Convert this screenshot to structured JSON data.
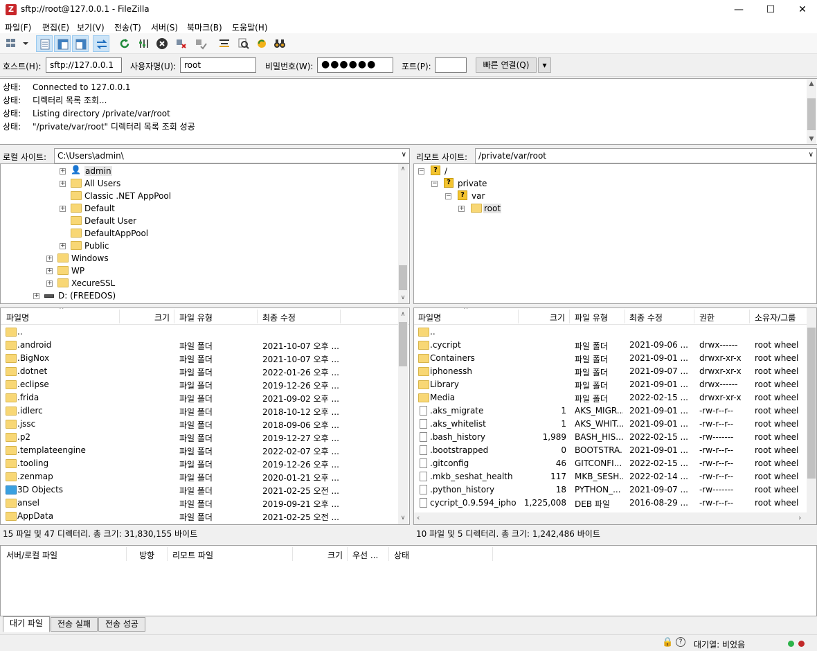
{
  "window": {
    "title": "sftp://root@127.0.0.1 - FileZilla",
    "icon": "filezilla-icon"
  },
  "menu": [
    "파일(F)",
    "편집(E)",
    "보기(V)",
    "전송(T)",
    "서버(S)",
    "북마크(B)",
    "도움말(H)"
  ],
  "quickconnect": {
    "host_label": "호스트(H):",
    "host_value": "sftp://127.0.0.1",
    "user_label": "사용자명(U):",
    "user_value": "root",
    "pass_label": "비밀번호(W):",
    "pass_value": "●●●●●●",
    "port_label": "포트(P):",
    "port_value": "",
    "connect_label": "빠른 연결(Q)",
    "dropdown": "▾"
  },
  "log": [
    {
      "key": "상태:",
      "msg": "Connected to 127.0.0.1"
    },
    {
      "key": "상태:",
      "msg": "디렉터리 목록 조회..."
    },
    {
      "key": "상태:",
      "msg": "Listing directory /private/var/root"
    },
    {
      "key": "상태:",
      "msg": "\"/private/var/root\" 디렉터리 목록 조회 성공"
    }
  ],
  "local": {
    "site_label": "로컬 사이트:",
    "path": "C:\\Users\\admin\\",
    "tree": [
      {
        "label": "admin",
        "icon": "user-folder",
        "expander": true
      },
      {
        "label": "All Users",
        "icon": "folder",
        "expander": true
      },
      {
        "label": "Classic .NET AppPool",
        "icon": "folder",
        "expander": false
      },
      {
        "label": "Default",
        "icon": "folder",
        "expander": true
      },
      {
        "label": "Default User",
        "icon": "folder",
        "expander": false
      },
      {
        "label": "DefaultAppPool",
        "icon": "folder",
        "expander": false
      },
      {
        "label": "Public",
        "icon": "folder",
        "expander": true
      },
      {
        "label": "Windows",
        "icon": "folder",
        "expander": true
      },
      {
        "label": "WP",
        "icon": "folder",
        "expander": true
      },
      {
        "label": "XecureSSL",
        "icon": "folder",
        "expander": true
      },
      {
        "label": "D: (FREEDOS)",
        "icon": "drive",
        "expander": true
      }
    ],
    "columns": [
      "파일명",
      "크기",
      "파일 유형",
      "최종 수정"
    ],
    "files": [
      {
        "name": "..",
        "size": "",
        "type": "",
        "modified": ""
      },
      {
        "name": ".android",
        "size": "",
        "type": "파일 폴더",
        "modified": "2021-10-07 오후 ..."
      },
      {
        "name": ".BigNox",
        "size": "",
        "type": "파일 폴더",
        "modified": "2021-10-07 오후 ..."
      },
      {
        "name": ".dotnet",
        "size": "",
        "type": "파일 폴더",
        "modified": "2022-01-26 오후 ..."
      },
      {
        "name": ".eclipse",
        "size": "",
        "type": "파일 폴더",
        "modified": "2019-12-26 오후 ..."
      },
      {
        "name": ".frida",
        "size": "",
        "type": "파일 폴더",
        "modified": "2021-09-02 오후 ..."
      },
      {
        "name": ".idlerc",
        "size": "",
        "type": "파일 폴더",
        "modified": "2018-10-12 오후 ..."
      },
      {
        "name": ".jssc",
        "size": "",
        "type": "파일 폴더",
        "modified": "2018-09-06 오후 ..."
      },
      {
        "name": ".p2",
        "size": "",
        "type": "파일 폴더",
        "modified": "2019-12-27 오후 ..."
      },
      {
        "name": ".templateengine",
        "size": "",
        "type": "파일 폴더",
        "modified": "2022-02-07 오후 ..."
      },
      {
        "name": ".tooling",
        "size": "",
        "type": "파일 폴더",
        "modified": "2019-12-26 오후 ..."
      },
      {
        "name": ".zenmap",
        "size": "",
        "type": "파일 폴더",
        "modified": "2020-01-21 오후 ..."
      },
      {
        "name": "3D Objects",
        "size": "",
        "type": "파일 폴더",
        "modified": "2021-02-25 오전 ..."
      },
      {
        "name": "ansel",
        "size": "",
        "type": "파일 폴더",
        "modified": "2019-09-21 오후 ..."
      },
      {
        "name": "AppData",
        "size": "",
        "type": "파일 폴더",
        "modified": "2021-02-25 오전 ..."
      }
    ],
    "status": "15 파일 및 47 디렉터리. 총 크기: 31,830,155 바이트"
  },
  "remote": {
    "site_label": "리모트 사이트:",
    "path": "/private/var/root",
    "tree": [
      {
        "label": "/",
        "depth": 0
      },
      {
        "label": "private",
        "depth": 1
      },
      {
        "label": "var",
        "depth": 2
      },
      {
        "label": "root",
        "depth": 3
      }
    ],
    "columns": [
      "파일명",
      "크기",
      "파일 유형",
      "최종 수정",
      "권한",
      "소유자/그룹"
    ],
    "files": [
      {
        "name": "..",
        "size": "",
        "type": "",
        "modified": "",
        "perm": "",
        "owner": "",
        "kind": "folder"
      },
      {
        "name": ".cycript",
        "size": "",
        "type": "파일 폴더",
        "modified": "2021-09-06 ...",
        "perm": "drwx------",
        "owner": "root wheel",
        "kind": "folder"
      },
      {
        "name": "Containers",
        "size": "",
        "type": "파일 폴더",
        "modified": "2021-09-01 ...",
        "perm": "drwxr-xr-x",
        "owner": "root wheel",
        "kind": "folder"
      },
      {
        "name": "iphonessh",
        "size": "",
        "type": "파일 폴더",
        "modified": "2021-09-07 ...",
        "perm": "drwxr-xr-x",
        "owner": "root wheel",
        "kind": "folder"
      },
      {
        "name": "Library",
        "size": "",
        "type": "파일 폴더",
        "modified": "2021-09-01 ...",
        "perm": "drwx------",
        "owner": "root wheel",
        "kind": "folder"
      },
      {
        "name": "Media",
        "size": "",
        "type": "파일 폴더",
        "modified": "2022-02-15 ...",
        "perm": "drwxr-xr-x",
        "owner": "root wheel",
        "kind": "folder"
      },
      {
        "name": ".aks_migrate",
        "size": "1",
        "type": "AKS_MIGR...",
        "modified": "2021-09-01 ...",
        "perm": "-rw-r--r--",
        "owner": "root wheel",
        "kind": "file"
      },
      {
        "name": ".aks_whitelist",
        "size": "1",
        "type": "AKS_WHIT...",
        "modified": "2021-09-01 ...",
        "perm": "-rw-r--r--",
        "owner": "root wheel",
        "kind": "file"
      },
      {
        "name": ".bash_history",
        "size": "1,989",
        "type": "BASH_HIS...",
        "modified": "2022-02-15 ...",
        "perm": "-rw-------",
        "owner": "root wheel",
        "kind": "file"
      },
      {
        "name": ".bootstrapped",
        "size": "0",
        "type": "BOOTSTRA...",
        "modified": "2021-09-01 ...",
        "perm": "-rw-r--r--",
        "owner": "root wheel",
        "kind": "file"
      },
      {
        "name": ".gitconfig",
        "size": "46",
        "type": "GITCONFI...",
        "modified": "2022-02-15 ...",
        "perm": "-rw-r--r--",
        "owner": "root wheel",
        "kind": "file"
      },
      {
        "name": ".mkb_seshat_health",
        "size": "117",
        "type": "MKB_SESH...",
        "modified": "2022-02-14 ...",
        "perm": "-rw-r--r--",
        "owner": "root wheel",
        "kind": "file"
      },
      {
        "name": ".python_history",
        "size": "18",
        "type": "PYTHON_...",
        "modified": "2021-09-07 ...",
        "perm": "-rw-------",
        "owner": "root wheel",
        "kind": "file"
      },
      {
        "name": "cycript_0.9.594_ipho...",
        "size": "1,225,008",
        "type": "DEB 파일",
        "modified": "2016-08-29 ...",
        "perm": "-rw-r--r--",
        "owner": "root wheel",
        "kind": "file"
      }
    ],
    "status": "10 파일 및 5 디렉터리. 총 크기: 1,242,486 바이트"
  },
  "queue": {
    "columns": [
      "서버/로컬 파일",
      "방향",
      "리모트 파일",
      "크기",
      "우선 ...",
      "상태"
    ],
    "tabs": [
      "대기 파일",
      "전송 실패",
      "전송 성공"
    ]
  },
  "statusbar": {
    "queue_text": "대기열: 비었음"
  }
}
